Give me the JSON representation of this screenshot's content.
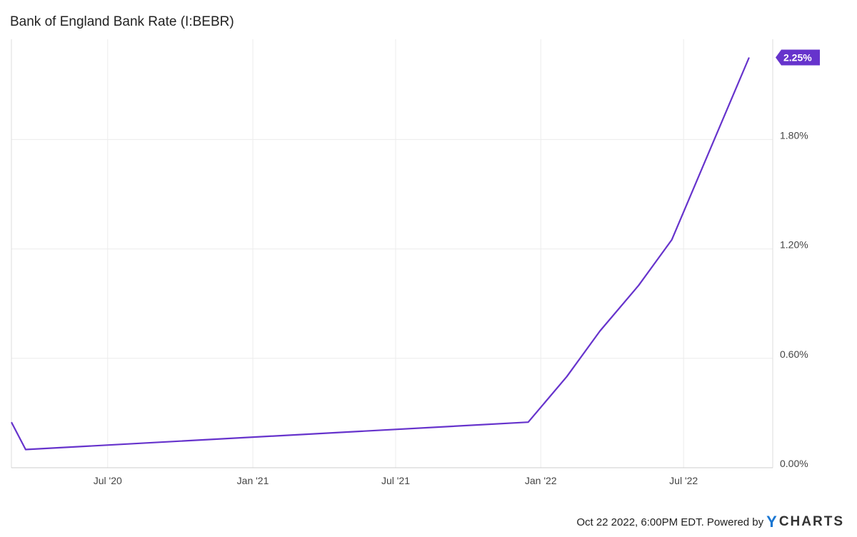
{
  "chart_data": {
    "type": "line",
    "title": "Bank of England Bank Rate (I:BEBR)",
    "x_ticks": [
      "Jul '20",
      "Jan '21",
      "Jul '21",
      "Jan '22",
      "Jul '22"
    ],
    "y_ticks": [
      "0.00%",
      "0.60%",
      "1.20%",
      "1.80%"
    ],
    "ylim": [
      0,
      2.35
    ],
    "xlim": [
      "2020-03-01",
      "2022-10-22"
    ],
    "grid": true,
    "series": [
      {
        "color": "#6633cc",
        "end_label": "2.25%",
        "points": [
          {
            "x": "2020-03-01",
            "y": 0.25
          },
          {
            "x": "2020-03-19",
            "y": 0.1
          },
          {
            "x": "2021-12-16",
            "y": 0.25
          },
          {
            "x": "2022-02-03",
            "y": 0.5
          },
          {
            "x": "2022-03-17",
            "y": 0.75
          },
          {
            "x": "2022-05-05",
            "y": 1.0
          },
          {
            "x": "2022-06-16",
            "y": 1.25
          },
          {
            "x": "2022-09-22",
            "y": 2.25
          }
        ]
      }
    ]
  },
  "footer": {
    "timestamp": "Oct 22 2022, 6:00PM EDT. Powered by",
    "logo_y": "Y",
    "logo_rest": "CHARTS"
  }
}
